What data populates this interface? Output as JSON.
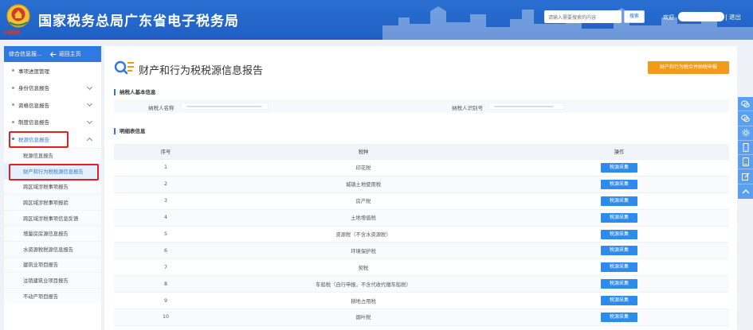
{
  "header": {
    "site_title": "国家税务总局广东省电子税务局",
    "emblem_caption": "中国税务",
    "search_placeholder": "请输入需要搜索的内容",
    "search_button": "搜索",
    "welcome": "欢迎",
    "logout": "| 退出"
  },
  "sidebar": {
    "head_title": "综合信息报...",
    "back_label": "返回主页",
    "items": [
      {
        "label": "事项进度管理"
      },
      {
        "label": "身份信息报告"
      },
      {
        "label": "资格信息报告"
      },
      {
        "label": "制度信息报告"
      },
      {
        "label": "税源信息报告"
      }
    ],
    "sub_items": [
      {
        "label": "税源信息报告"
      },
      {
        "label": "财产和行为税税源信息报告"
      },
      {
        "label": "跨区域涉税事项报告"
      },
      {
        "label": "跨区域涉税事项报验"
      },
      {
        "label": "跨区域涉税事项信息反馈"
      },
      {
        "label": "增量房房源信息报告"
      },
      {
        "label": "水资源税税源信息报告"
      },
      {
        "label": "建筑业项目报告"
      },
      {
        "label": "注销建筑业项目报告"
      },
      {
        "label": "不动产项目报告"
      }
    ]
  },
  "main": {
    "page_title": "财产和行为税税源信息报告",
    "merge_button": "财产和行为税合并纳税申报",
    "basic_section": "纳税人基本信息",
    "taxpayer_name_label": "纳税人名称",
    "taxpayer_id_label": "纳税人识别号",
    "detail_section": "明细表信息",
    "table": {
      "headers": [
        "序号",
        "税种",
        "操作"
      ],
      "action_label": "税源采集",
      "rows": [
        {
          "no": "1",
          "tax": "印花税"
        },
        {
          "no": "2",
          "tax": "城镇土地使用税"
        },
        {
          "no": "3",
          "tax": "房产税"
        },
        {
          "no": "4",
          "tax": "土地增值税"
        },
        {
          "no": "5",
          "tax": "资源税（不含水资源税）"
        },
        {
          "no": "6",
          "tax": "环境保护税"
        },
        {
          "no": "7",
          "tax": "契税"
        },
        {
          "no": "8",
          "tax": "车船税（自行申报，不含代收代缴车船税）"
        },
        {
          "no": "9",
          "tax": "耕地占用税"
        },
        {
          "no": "10",
          "tax": "烟叶税"
        }
      ]
    }
  },
  "colors": {
    "header_blue": "#2a6fd1",
    "accent_blue": "#2e7ae0",
    "button_blue": "#2e8bec",
    "orange": "#f39a1b",
    "highlight_red": "#e02020"
  },
  "float_icons": [
    "chat-icon",
    "chat-icon",
    "gear-icon",
    "phone-icon",
    "tablet-icon",
    "edit-icon",
    "chevron-up-icon"
  ]
}
